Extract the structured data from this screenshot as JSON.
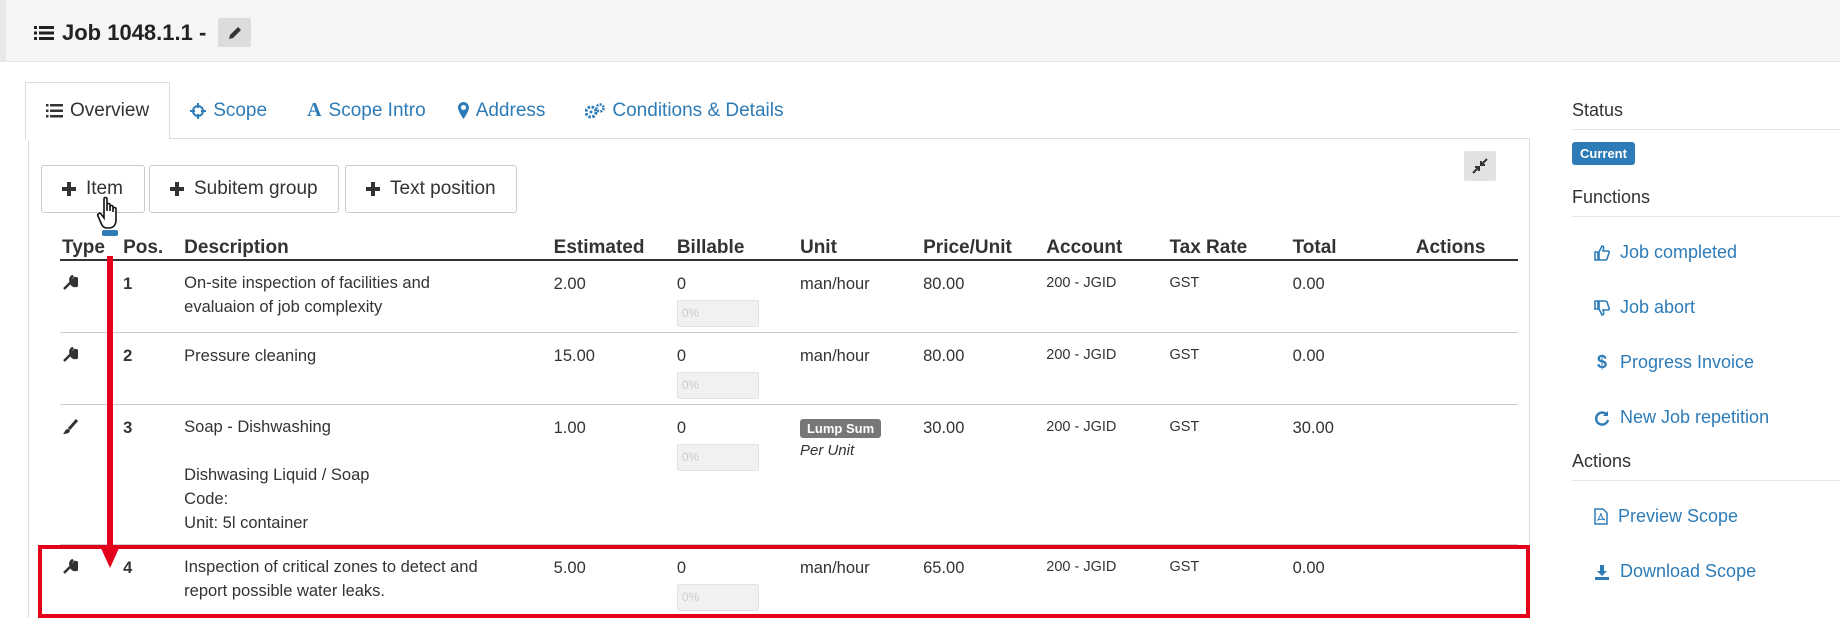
{
  "header": {
    "title": "Job 1048.1.1 -"
  },
  "tabs": [
    {
      "label": "Overview",
      "icon": "list-icon"
    },
    {
      "label": "Scope",
      "icon": "crosshair-icon"
    },
    {
      "label": "Scope Intro",
      "icon": "font-icon"
    },
    {
      "label": "Address",
      "icon": "map-marker-icon"
    },
    {
      "label": "Conditions & Details",
      "icon": "gears-icon"
    }
  ],
  "toolbar": {
    "add_item": "Item",
    "add_subitem_group": "Subitem group",
    "add_text_position": "Text position"
  },
  "table": {
    "columns": [
      "Type",
      "Pos.",
      "Description",
      "Estimated",
      "Billable",
      "Unit",
      "Price/Unit",
      "Account",
      "Tax Rate",
      "Total",
      "Actions"
    ],
    "rows": [
      {
        "type_icon": "wrench-icon",
        "pos": "1",
        "description": [
          "On-site inspection of facilities and",
          "evaluaion of job complexity"
        ],
        "estimated": "2.00",
        "billable": "0",
        "billable_placeholder": "0%",
        "unit": "man/hour",
        "price": "80.00",
        "account": "200 - JGID",
        "tax": "GST",
        "total": "0.00"
      },
      {
        "type_icon": "wrench-icon",
        "pos": "2",
        "description": [
          "Pressure cleaning"
        ],
        "estimated": "15.00",
        "billable": "0",
        "billable_placeholder": "0%",
        "unit": "man/hour",
        "price": "80.00",
        "account": "200 - JGID",
        "tax": "GST",
        "total": "0.00"
      },
      {
        "type_icon": "brush-icon",
        "pos": "3",
        "description": [
          "Soap - Dishwashing",
          "",
          "Dishwasing Liquid / Soap",
          "Code:",
          "Unit: 5l container"
        ],
        "estimated": "1.00",
        "billable": "0",
        "billable_placeholder": "0%",
        "unit_badge": "Lump Sum",
        "unit_sub": "Per Unit",
        "price": "30.00",
        "account": "200 - JGID",
        "tax": "GST",
        "total": "30.00"
      },
      {
        "type_icon": "wrench-icon",
        "pos": "4",
        "description": [
          "Inspection of critical zones to detect and",
          "report possible water leaks."
        ],
        "estimated": "5.00",
        "billable": "0",
        "billable_placeholder": "0%",
        "unit": "man/hour",
        "price": "65.00",
        "account": "200 - JGID",
        "tax": "GST",
        "total": "0.00"
      }
    ]
  },
  "sidebar": {
    "status_heading": "Status",
    "status_badge": "Current",
    "functions_heading": "Functions",
    "functions": [
      {
        "label": "Job completed",
        "icon": "thumbs-up-icon"
      },
      {
        "label": "Job abort",
        "icon": "thumbs-down-icon"
      },
      {
        "label": "Progress Invoice",
        "icon": "dollar-icon"
      },
      {
        "label": "New Job repetition",
        "icon": "refresh-icon"
      }
    ],
    "actions_heading": "Actions",
    "actions": [
      {
        "label": "Preview Scope",
        "icon": "file-pdf-icon"
      },
      {
        "label": "Download Scope",
        "icon": "download-icon"
      }
    ]
  },
  "colors": {
    "link": "#2d7bb7",
    "highlight": "#e2001a",
    "badge": "#2d7bb7"
  }
}
